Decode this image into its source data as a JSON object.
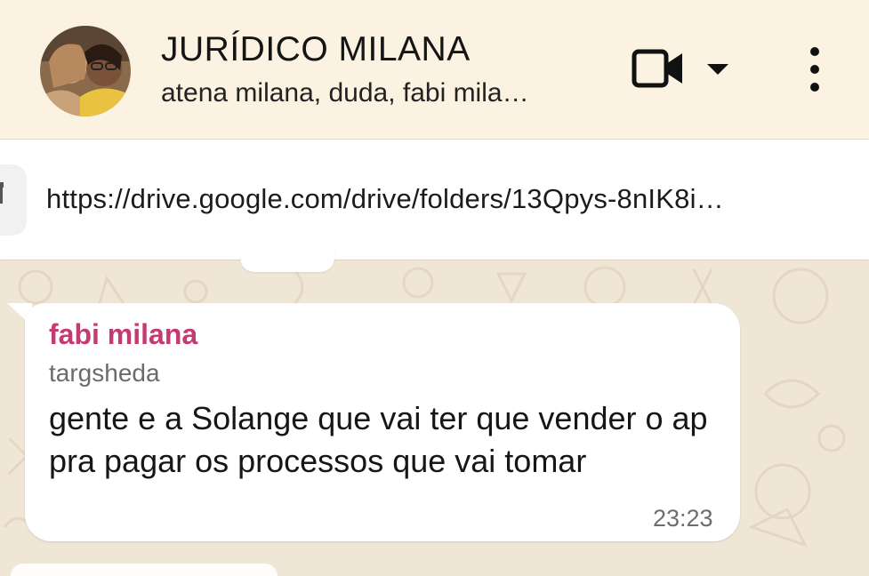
{
  "header": {
    "title": "JURÍDICO MILANA",
    "subtitle": "atena milana, duda, fabi mila…",
    "bg_color": "#fbf2e2"
  },
  "pinned": {
    "text": "https://drive.google.com/drive/folders/13Qpys-8nIK8i…"
  },
  "icons": {
    "avatar": "group-avatar",
    "video": "video-camera-icon",
    "caret": "caret-down-icon",
    "menu": "more-vertical-icon",
    "pin": "pin-icon"
  },
  "message": {
    "sender": "fabi milana",
    "sender_note": "targsheda",
    "text": "gente e a Solange que vai ter que vender o ap pra pagar os processos que vai tomar",
    "time": "23:23",
    "sender_color": "#c43a72"
  },
  "chat": {
    "wallpaper_color": "#efe6d6"
  }
}
